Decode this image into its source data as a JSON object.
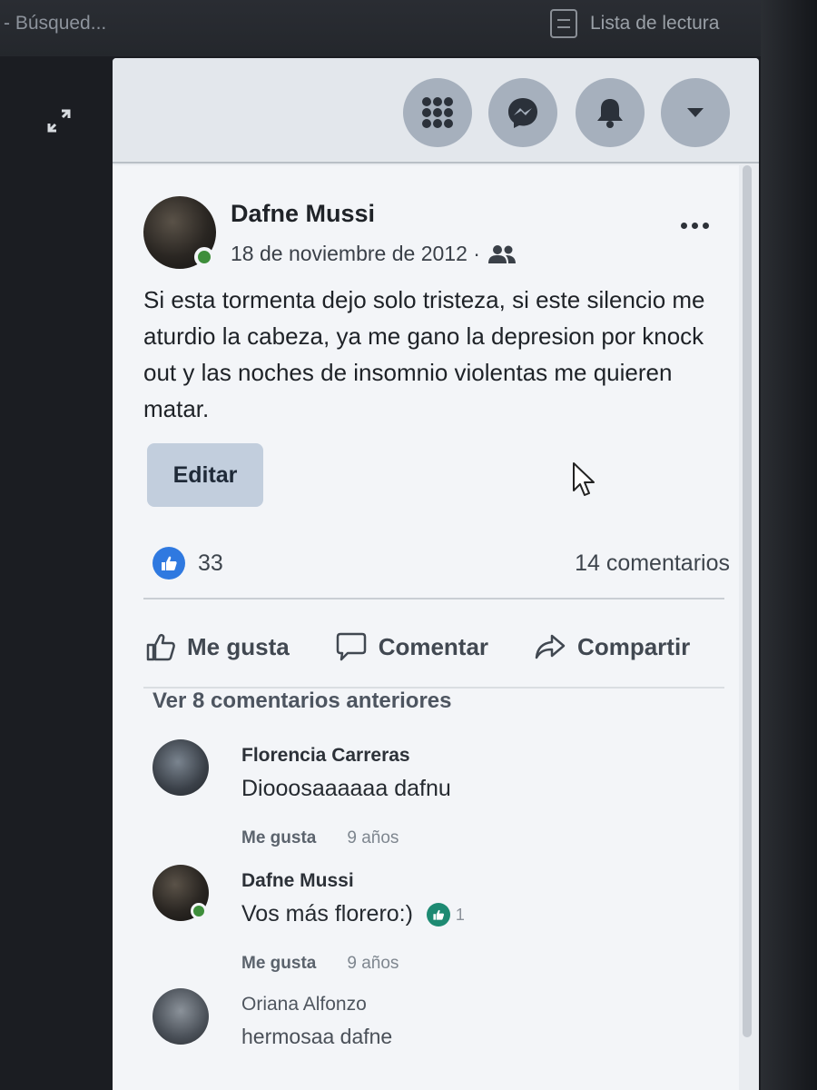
{
  "browser": {
    "search_text": "- Búsqued...",
    "reading_list_label": "Lista de lectura"
  },
  "header": {
    "buttons": [
      "menu-grid-icon",
      "messenger-icon",
      "notifications-bell-icon",
      "account-caret-icon"
    ]
  },
  "post": {
    "author": "Dafne Mussi",
    "date": "18 de noviembre de 2012 ·",
    "audience_icon": "friends-icon",
    "text": "Si esta tormenta dejo solo tristeza, si este silencio me aturdio la cabeza, ya me gano la depresion por knock out y las noches de insomnio violentas me quieren matar.",
    "edit_label": "Editar",
    "likes": "33",
    "comments_count": "14 comentarios",
    "actions": {
      "like": "Me gusta",
      "comment": "Comentar",
      "share": "Compartir"
    },
    "previous_comments": "Ver 8 comentarios anteriores"
  },
  "comments": [
    {
      "name": "Florencia Carreras",
      "text": "Diooosaaaaaa dafnu",
      "like_label": "Me gusta",
      "time": "9 años"
    },
    {
      "name": "Dafne Mussi",
      "text": "Vos más florero:)",
      "reaction_count": "1",
      "like_label": "Me gusta",
      "time": "9 años"
    },
    {
      "name": "Oriana Alfonzo",
      "text": "hermosaa dafne"
    }
  ],
  "colors": {
    "like_blue": "#2f79e0",
    "online_green": "#3e8e3b",
    "reaction_teal": "#1d8a72",
    "header_button": "#a6b0bd"
  }
}
